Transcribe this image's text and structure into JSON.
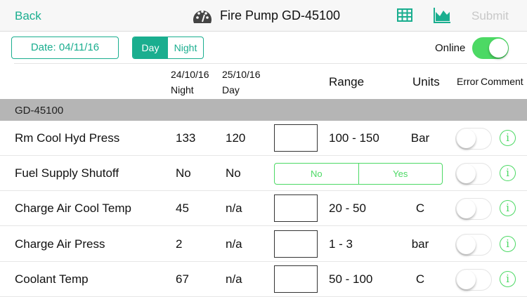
{
  "nav": {
    "back": "Back",
    "title": "Fire Pump GD-45100",
    "submit": "Submit",
    "icons": [
      "gauge-icon",
      "table-icon",
      "chart-icon"
    ]
  },
  "controls": {
    "date": "Date: 04/11/16",
    "day": "Day",
    "night": "Night",
    "online": "Online",
    "online_on": true
  },
  "headers": {
    "col1_date": "24/10/16",
    "col1_shift": "Night",
    "col2_date": "25/10/16",
    "col2_shift": "Day",
    "range": "Range",
    "units": "Units",
    "error": "Error",
    "comment": "Comment"
  },
  "section": "GD-45100",
  "rows": [
    {
      "name": "Rm Cool Hyd Press",
      "v1": "133",
      "v2": "120",
      "range": "100 - 150",
      "units": "Bar"
    },
    {
      "name": "Fuel Supply Shutoff",
      "v1": "No",
      "v2": "No",
      "no": "No",
      "yes": "Yes"
    },
    {
      "name": "Charge Air Cool Temp",
      "v1": "45",
      "v2": "n/a",
      "range": "20 - 50",
      "units": "C"
    },
    {
      "name": "Charge Air Press",
      "v1": "2",
      "v2": "n/a",
      "range": "1 - 3",
      "units": "bar"
    },
    {
      "name": "Coolant Temp",
      "v1": "67",
      "v2": "n/a",
      "range": "50 - 100",
      "units": "C"
    }
  ],
  "colors": {
    "accent": "#1aae8f",
    "green": "#4cd964"
  }
}
